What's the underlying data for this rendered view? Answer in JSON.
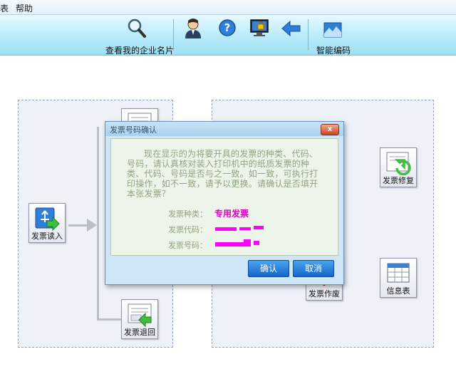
{
  "menu": {
    "left_partial": "表",
    "help": "帮助"
  },
  "toolbar": {
    "business_card_label": "查看我的企业名片",
    "smart_code_label": "智能编码",
    "icons": [
      "magnifier-icon",
      "user-icon",
      "help-icon",
      "lock-screen-icon",
      "back-arrow-icon",
      "smart-code-icon"
    ]
  },
  "tiles": {
    "invoice_read": "发票读入",
    "invoice_return": "发票退回",
    "invoice_repair": "发票修复",
    "invoice_void": "发票作废",
    "info_table": "信息表"
  },
  "dialog": {
    "title": "发票号码确认",
    "close": "x",
    "message": "现在显示的为将要开具的发票的种类、代码、号码，请认真核对装入打印机中的纸质发票的种类、代码、号码是否与之一致。如一致，可执行打印操作，如不一致，请予以更换。请确认是否填开本张发票？",
    "type_label": "发票种类：",
    "type_value": "专用发票",
    "code_label": "发票代码：",
    "number_label": "发票号码：",
    "confirm": "确认",
    "cancel": "取消"
  },
  "colors": {
    "accent": "#1565c8",
    "highlight": "#e000c8",
    "redaction": "#ff00ff"
  }
}
